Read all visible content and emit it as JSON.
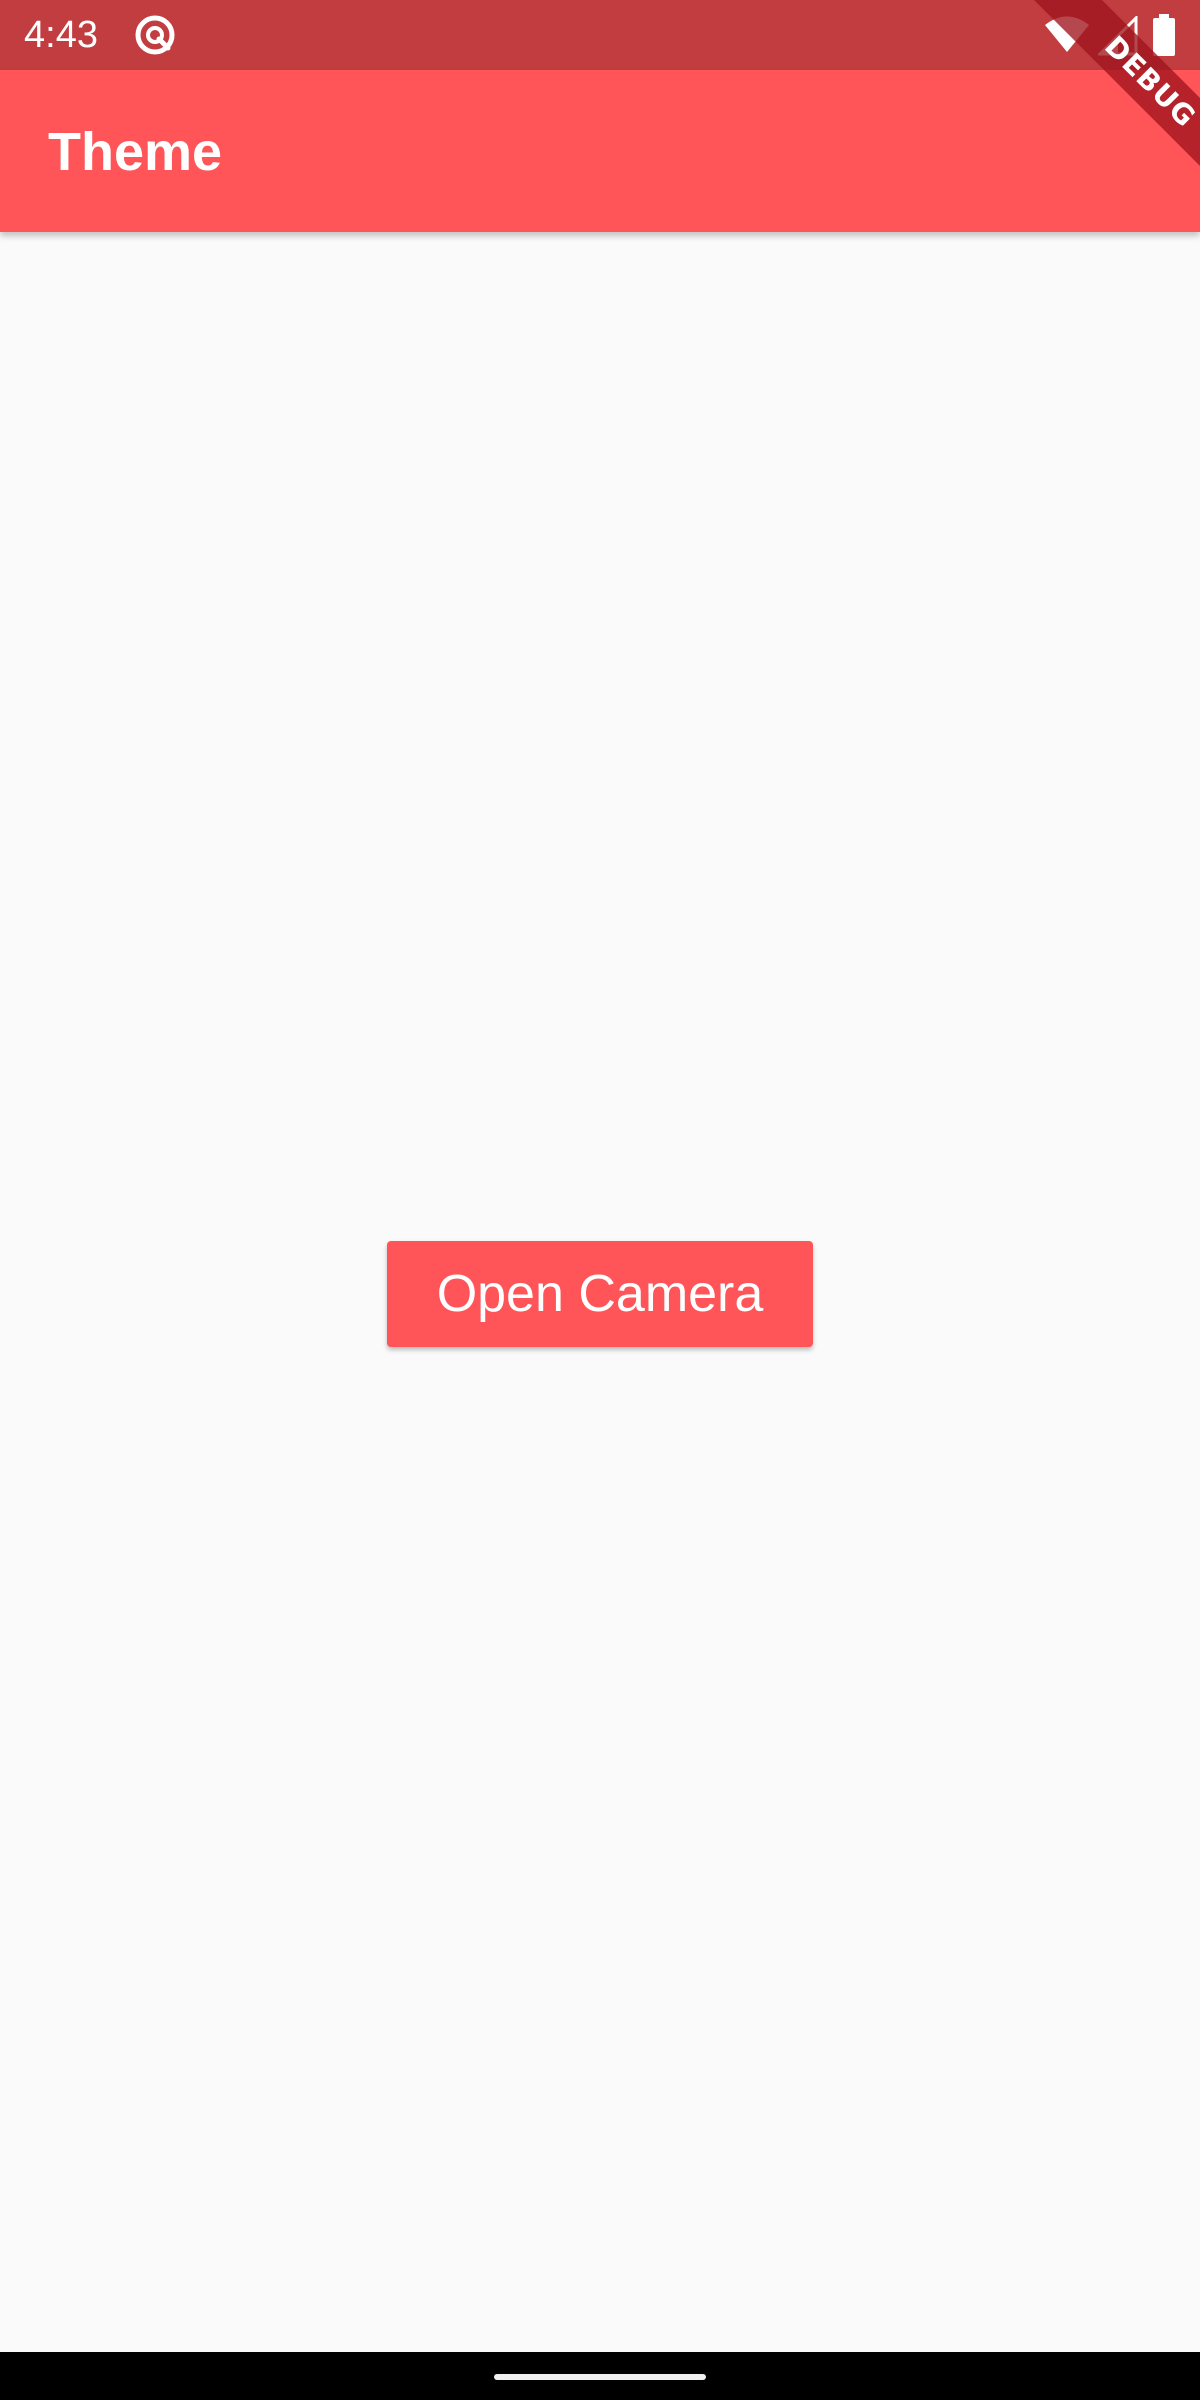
{
  "status_bar": {
    "time": "4:43",
    "background": "#C13D40",
    "icons": [
      "app-notification-icon",
      "wifi-icon",
      "cellular-signal-icon",
      "battery-icon"
    ]
  },
  "app_bar": {
    "title": "Theme",
    "background": "#FF5558"
  },
  "debug_banner": {
    "label": "DEBUG"
  },
  "main": {
    "open_camera_label": "Open Camera",
    "background": "#FAFAFA"
  },
  "nav_bar": {
    "background": "#000000"
  }
}
